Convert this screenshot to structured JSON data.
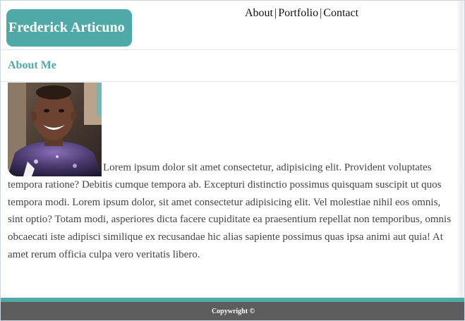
{
  "header": {
    "logo_text": "Frederick Articuno",
    "nav": [
      {
        "label": "About"
      },
      {
        "label": "Portfolio"
      },
      {
        "label": "Contact"
      }
    ],
    "separator": "|"
  },
  "section": {
    "title": "About Me"
  },
  "content": {
    "photo_alt": "profile photo",
    "paragraph": "Lorem ipsum dolor sit amet consectetur, adipisicing elit. Provident voluptates tempora ratione? Debitis cumque tempora ab. Excepturi distinctio possimus quisquam suscipit ut quos tempora modi. Lorem ipsum dolor, sit amet consectetur adipisicing elit. Vel molestiae nihil eos omnis, sint optio? Totam modi, asperiores dicta facere cupiditate ea praesentium repellat non temporibus, omnis obcaecati iste adipisci similique ex recusandae hic alias sapiente possimus quas ipsa animi aut quia! At amet rerum officia culpa vero veritatis libero."
  },
  "footer": {
    "copyright": "Copywright ©"
  },
  "colors": {
    "accent": "#4fa9a6",
    "footer_bg": "#5d5d5d",
    "text": "#444444"
  }
}
